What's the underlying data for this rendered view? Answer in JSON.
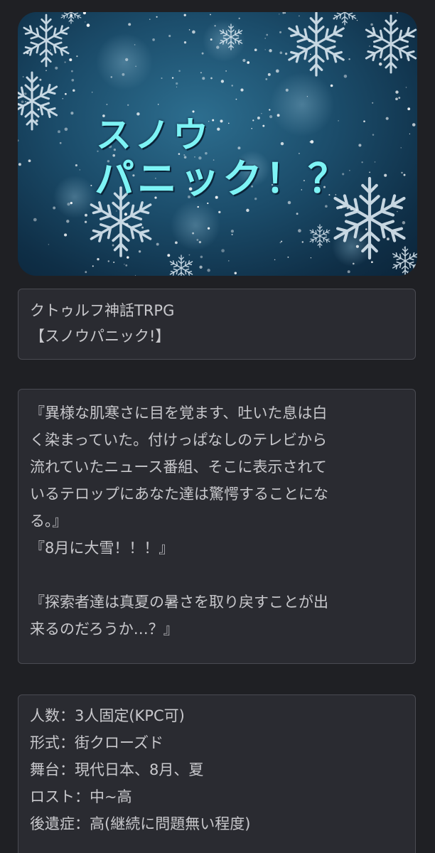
{
  "hero": {
    "title_line1": "スノウ",
    "title_line2": "パニック！？",
    "colors": {
      "title": "#7df3f5",
      "background": "#1b4c6a"
    }
  },
  "summary": {
    "system": "クトゥルフ神話TRPG",
    "scenario_title": "【スノウパニック!】"
  },
  "intro": {
    "lines": [
      "『異様な肌寒さに目を覚ます、吐いた息は白",
      "く染まっていた。付けっぱなしのテレビから",
      "流れていたニュース番組、そこに表示されて",
      "いるテロップにあなた達は驚愕することにな",
      "る。』",
      "『8月に大雪！！！』",
      "",
      "『探索者達は真夏の暑さを取り戻すことが出",
      "来るのだろうか…？』"
    ]
  },
  "details": {
    "lines": [
      "人数：3人固定(KPC可)",
      "形式：街クローズド",
      "舞台：現代日本、8月、夏",
      "ロスト：中~高",
      "後遺症：高(継続に問題無い程度)"
    ]
  }
}
